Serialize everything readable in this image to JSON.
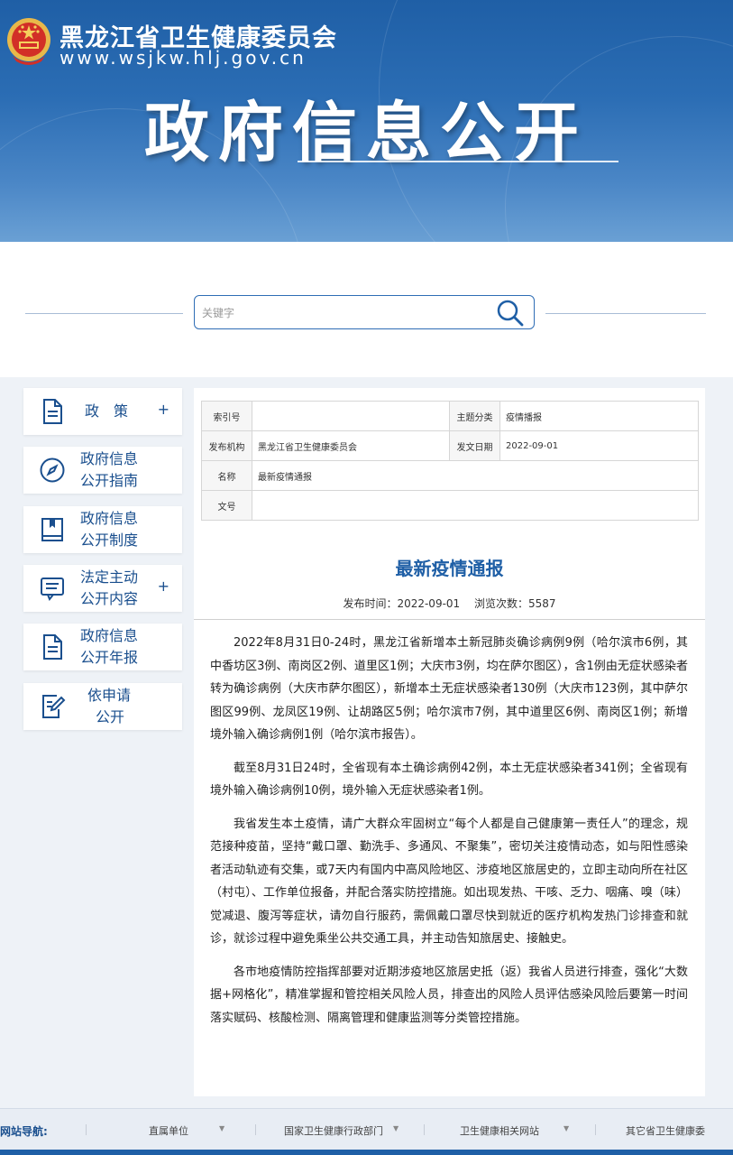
{
  "header": {
    "site_name": "黑龙江省卫生健康委员会",
    "site_url": "www.wsjkw.hlj.gov.cn",
    "banner_title": "政府信息公开",
    "emblem_icon": "national-emblem-icon"
  },
  "search": {
    "placeholder": "关键字",
    "icon": "search-icon"
  },
  "sidebar": {
    "items": [
      {
        "label_line1": "政　策",
        "label_line2": "",
        "expand": "+",
        "icon": "document-icon"
      },
      {
        "label_line1": "政府信息",
        "label_line2": "公开指南",
        "expand": "",
        "icon": "compass-icon"
      },
      {
        "label_line1": "政府信息",
        "label_line2": "公开制度",
        "expand": "",
        "icon": "book-icon"
      },
      {
        "label_line1": "法定主动",
        "label_line2": "公开内容",
        "expand": "+",
        "icon": "chat-list-icon"
      },
      {
        "label_line1": "政府信息",
        "label_line2": "公开年报",
        "expand": "",
        "icon": "report-icon"
      },
      {
        "label_line1": "依申请",
        "label_line2": "公开",
        "expand": "",
        "icon": "edit-form-icon"
      }
    ]
  },
  "meta": {
    "index_label": "索引号",
    "index_value": "",
    "topic_label": "主题分类",
    "topic_value": "疫情播报",
    "publisher_label": "发布机构",
    "publisher_value": "黑龙江省卫生健康委员会",
    "date_label": "发文日期",
    "date_value": "2022-09-01",
    "name_label": "名称",
    "name_value": "最新疫情通报",
    "docno_label": "文号",
    "docno_value": ""
  },
  "article": {
    "title": "最新疫情通报",
    "publish_time": "发布时间：2022-09-01",
    "views": "浏览次数：5587",
    "paragraphs": [
      "2022年8月31日0-24时，黑龙江省新增本土新冠肺炎确诊病例9例（哈尔滨市6例，其中香坊区3例、南岗区2例、道里区1例；大庆市3例，均在萨尔图区），含1例由无症状感染者转为确诊病例（大庆市萨尔图区），新增本土无症状感染者130例（大庆市123例，其中萨尔图区99例、龙凤区19例、让胡路区5例；哈尔滨市7例，其中道里区6例、南岗区1例；新增境外输入确诊病例1例（哈尔滨市报告）。",
      "截至8月31日24时，全省现有本土确诊病例42例，本土无症状感染者341例；全省现有境外输入确诊病例10例，境外输入无症状感染者1例。",
      "我省发生本土疫情，请广大群众牢固树立“每个人都是自己健康第一责任人”的理念，规范接种疫苗，坚持“戴口罩、勤洗手、多通风、不聚集”，密切关注疫情动态，如与阳性感染者活动轨迹有交集，或7天内有国内中高风险地区、涉疫地区旅居史的，立即主动向所在社区（村屯）、工作单位报备，并配合落实防控措施。如出现发热、干咳、乏力、咽痛、嗅（味）觉减退、腹泻等症状，请勿自行服药，需佩戴口罩尽快到就近的医疗机构发热门诊排查和就诊，就诊过程中避免乘坐公共交通工具，并主动告知旅居史、接触史。",
      "各市地疫情防控指挥部要对近期涉疫地区旅居史抵（返）我省人员进行排查，强化“大数据+网格化”，精准掌握和管控相关风险人员，排查出的风险人员评估感染风险后要第一时间落实赋码、核酸检测、隔离管理和健康监测等分类管控措施。"
    ]
  },
  "footer": {
    "label": "网站导航:",
    "items": [
      "直属单位",
      "国家卫生健康行政部门",
      "卫生健康相关网站",
      "其它省卫生健康委"
    ],
    "arrow": "▼"
  }
}
